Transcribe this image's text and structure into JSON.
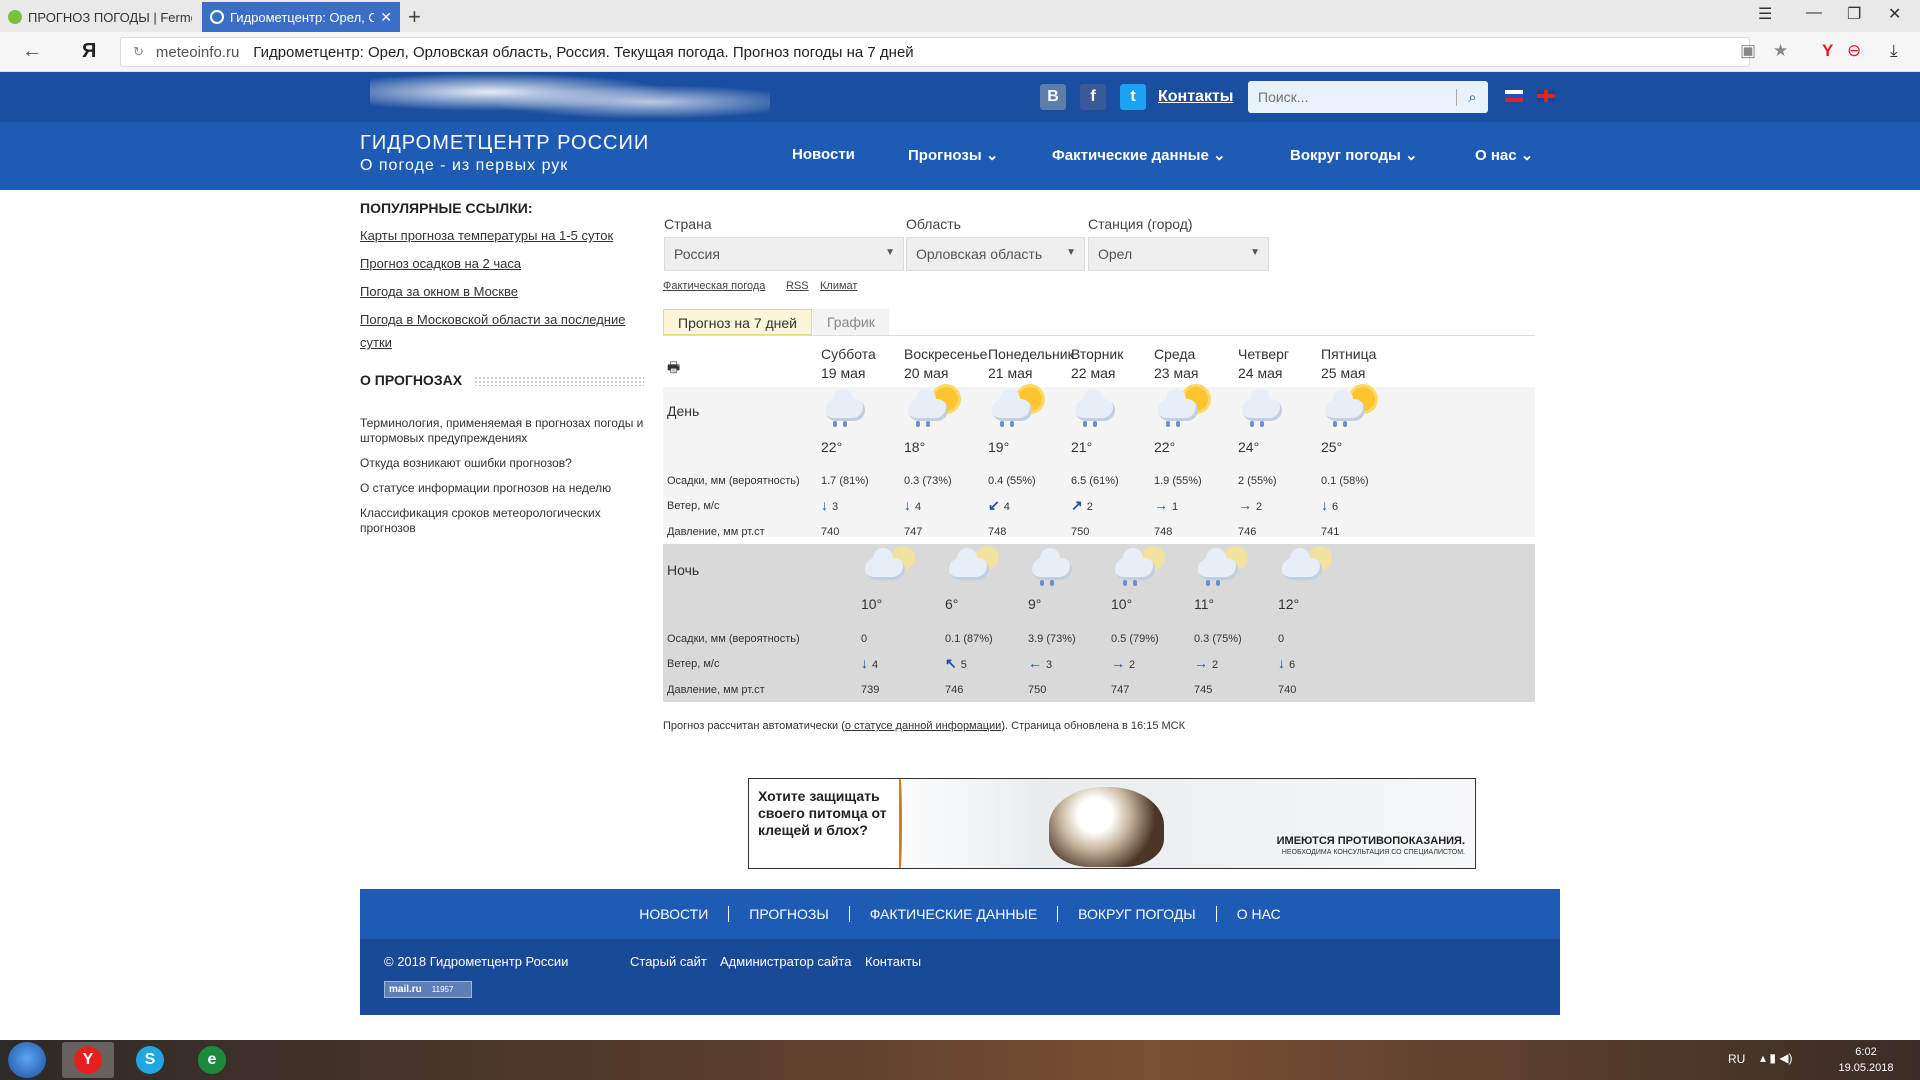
{
  "browser": {
    "tabs": [
      {
        "title": "ПРОГНОЗ ПОГОДЫ | Ferme",
        "active": false
      },
      {
        "title": "Гидрометцентр: Орел, О",
        "active": true
      }
    ],
    "address": {
      "domain": "meteoinfo.ru",
      "title": "Гидрометцентр: Орел, Орловская область, Россия. Текущая погода. Прогноз погоды на 7 дней"
    }
  },
  "site": {
    "social": [
      "В",
      "f",
      "t"
    ],
    "contacts_label": "Контакты",
    "search_placeholder": "Поиск...",
    "brand_title": "ГИДРОМЕТЦЕНТР РОССИИ",
    "brand_subtitle": "О погоде - из первых рук",
    "nav": [
      "Новости",
      "Прогнозы",
      "Фактические данные",
      "Вокруг погоды",
      "О нас"
    ]
  },
  "sidebar": {
    "popular_heading": "ПОПУЛЯРНЫЕ ССЫЛКИ:",
    "popular_links": [
      "Карты прогноза температуры на 1-5 суток",
      "Прогноз осадков на 2 часа",
      "Погода за окном в Москве",
      "Погода в Московской области за последние сутки"
    ],
    "about_heading": "О ПРОГНОЗАХ",
    "about_links": [
      "Терминология, применяемая в прогнозах погоды и штормовых предупреждениях",
      "Откуда возникают ошибки прогнозов?",
      "О статусе информации прогнозов на неделю",
      "Классификация сроков метеорологических прогнозов"
    ]
  },
  "filters": {
    "country_label": "Страна",
    "country_value": "Россия",
    "region_label": "Область",
    "region_value": "Орловская область",
    "station_label": "Станция (город)",
    "station_value": "Орел",
    "links": [
      "Фактическая погода",
      "RSS",
      "Климат"
    ]
  },
  "tabs": {
    "seven_days": "Прогноз на 7 дней",
    "graph": "График"
  },
  "forecast": {
    "day_label": "День",
    "night_label": "Ночь",
    "row_precip": "Осадки, мм (вероятность)",
    "row_wind": "Ветер, м/с",
    "row_pressure": "Давление, мм рт.ст",
    "days": [
      {
        "name": "Суббота",
        "date": "19 мая",
        "temp": "22°",
        "precip": "1.7 (81%)",
        "wind_dir": "↓",
        "wind": "3",
        "pressure": "740",
        "icon": "cloud-rain-icon"
      },
      {
        "name": "Воскресенье",
        "date": "20 мая",
        "temp": "18°",
        "precip": "0.3 (73%)",
        "wind_dir": "↓",
        "wind": "4",
        "pressure": "747",
        "icon": "sun-cloud-rain-icon"
      },
      {
        "name": "Понедельник",
        "date": "21 мая",
        "temp": "19°",
        "precip": "0.4 (55%)",
        "wind_dir": "↙",
        "wind": "4",
        "pressure": "748",
        "icon": "sun-cloud-rain-icon"
      },
      {
        "name": "Вторник",
        "date": "22 мая",
        "temp": "21°",
        "precip": "6.5 (61%)",
        "wind_dir": "↗",
        "wind": "2",
        "pressure": "750",
        "icon": "cloud-rain-icon"
      },
      {
        "name": "Среда",
        "date": "23 мая",
        "temp": "22°",
        "precip": "1.9 (55%)",
        "wind_dir": "→",
        "wind": "1",
        "pressure": "748",
        "icon": "sun-cloud-rain-icon"
      },
      {
        "name": "Четверг",
        "date": "24 мая",
        "temp": "24°",
        "precip": "2 (55%)",
        "wind_dir": "→",
        "wind": "2",
        "pressure": "746",
        "icon": "cloud-rain-icon"
      },
      {
        "name": "Пятница",
        "date": "25 мая",
        "temp": "25°",
        "precip": "0.1 (58%)",
        "wind_dir": "↓",
        "wind": "6",
        "pressure": "741",
        "icon": "sun-cloud-rain-icon"
      }
    ],
    "nights": [
      {
        "temp": "10°",
        "precip": "0",
        "wind_dir": "↓",
        "wind": "4",
        "pressure": "739",
        "icon": "moon-cloud-icon"
      },
      {
        "temp": "6°",
        "precip": "0.1 (87%)",
        "wind_dir": "↖",
        "wind": "5",
        "pressure": "746",
        "icon": "moon-cloud-icon"
      },
      {
        "temp": "9°",
        "precip": "3.9 (73%)",
        "wind_dir": "←",
        "wind": "3",
        "pressure": "750",
        "icon": "cloud-rain-icon"
      },
      {
        "temp": "10°",
        "precip": "0.5 (79%)",
        "wind_dir": "→",
        "wind": "2",
        "pressure": "747",
        "icon": "moon-cloud-rain-icon"
      },
      {
        "temp": "11°",
        "precip": "0.3 (75%)",
        "wind_dir": "→",
        "wind": "2",
        "pressure": "745",
        "icon": "moon-cloud-rain-icon"
      },
      {
        "temp": "12°",
        "precip": "0",
        "wind_dir": "↓",
        "wind": "6",
        "pressure": "740",
        "icon": "moon-cloud-icon"
      }
    ],
    "note_prefix": "Прогноз рассчитан автоматически (",
    "note_link": "о статусе данной информации",
    "note_suffix": "). Страница обновлена в 16:15 МСК"
  },
  "ad": {
    "headline": "Хотите защищать своего питомца от клещей и блох?",
    "warning": "ИМЕЮТСЯ ПРОТИВОПОКАЗАНИЯ.",
    "warning_sub": "НЕОБХОДИМА КОНСУЛЬТАЦИЯ СО СПЕЦИАЛИСТОМ."
  },
  "footer": {
    "nav": [
      "НОВОСТИ",
      "ПРОГНОЗЫ",
      "ФАКТИЧЕСКИЕ ДАННЫЕ",
      "ВОКРУГ ПОГОДЫ",
      "О НАС"
    ],
    "copyright": "© 2018 Гидрометцентр России",
    "links": [
      "Старый сайт",
      "Администратор сайта",
      "Контакты"
    ],
    "counter_brand": "mail.ru",
    "counter_value": "11957"
  },
  "taskbar": {
    "lang": "RU",
    "time": "6:02",
    "date": "19.05.2018"
  }
}
